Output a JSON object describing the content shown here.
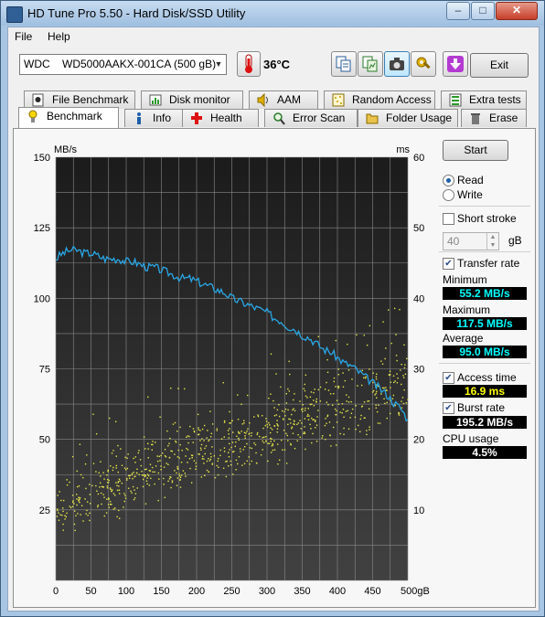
{
  "window": {
    "title": "HD Tune Pro 5.50 - Hard Disk/SSD Utility"
  },
  "titlebar_buttons": {
    "minimize": "–",
    "maximize": "□",
    "close": "✕"
  },
  "menu": {
    "file": "File",
    "help": "Help"
  },
  "toolbar": {
    "drive": "WDC    WD5000AAKX-001CA (500 gB)",
    "temperature": "36",
    "temperature_unit": "°C",
    "exit": "Exit"
  },
  "tabs_row1": [
    {
      "label": "File Benchmark",
      "icon": "file-benchmark-icon"
    },
    {
      "label": "Disk monitor",
      "icon": "disk-monitor-icon"
    },
    {
      "label": "AAM",
      "icon": "speaker-icon"
    },
    {
      "label": "Random Access",
      "icon": "random-access-icon"
    },
    {
      "label": "Extra tests",
      "icon": "extra-tests-icon"
    }
  ],
  "tabs_row2": [
    {
      "label": "Benchmark",
      "icon": "benchmark-icon"
    },
    {
      "label": "Info",
      "icon": "info-icon"
    },
    {
      "label": "Health",
      "icon": "health-icon"
    },
    {
      "label": "Error Scan",
      "icon": "magnifier-icon"
    },
    {
      "label": "Folder Usage",
      "icon": "folder-icon"
    },
    {
      "label": "Erase",
      "icon": "trash-icon"
    }
  ],
  "side": {
    "start": "Start",
    "read": "Read",
    "write": "Write",
    "short_stroke": "Short stroke",
    "short_stroke_value": "40",
    "short_stroke_unit": "gB",
    "transfer_rate": "Transfer rate",
    "minimum_label": "Minimum",
    "minimum": "55.2 MB/s",
    "maximum_label": "Maximum",
    "maximum": "117.5 MB/s",
    "average_label": "Average",
    "average": "95.0 MB/s",
    "access_time": "Access time",
    "access_time_value": "16.9 ms",
    "burst_rate": "Burst rate",
    "burst_rate_value": "195.2 MB/s",
    "cpu_usage_label": "CPU usage",
    "cpu_usage": "4.5%"
  },
  "colors": {
    "transfer_line": "#29a7e6",
    "access_points": "#e8e84a",
    "plot_bg_top": "#1b1b1b",
    "plot_bg_bottom": "#3f3f3f",
    "grid": "#8a8a8a"
  },
  "chart_data": {
    "type": "line",
    "left_unit": "MB/s",
    "right_unit": "ms",
    "x_unit": "gB",
    "xlim": [
      0,
      500
    ],
    "ylim_left": [
      0,
      150
    ],
    "ylim_right": [
      0,
      60
    ],
    "x_ticks": [
      0,
      50,
      100,
      150,
      200,
      250,
      300,
      350,
      400,
      450,
      500
    ],
    "y_ticks_left": [
      25,
      50,
      75,
      100,
      125,
      150
    ],
    "y_ticks_right": [
      10,
      20,
      30,
      40,
      50,
      60
    ],
    "grid": true,
    "series": [
      {
        "x": [
          0,
          10,
          20,
          30,
          40,
          50,
          60,
          70,
          80,
          90,
          100,
          110,
          120,
          130,
          140,
          150,
          160,
          170,
          180,
          190,
          200,
          210,
          220,
          230,
          240,
          250,
          260,
          270,
          280,
          290,
          300,
          310,
          320,
          330,
          340,
          350,
          360,
          370,
          380,
          390,
          400,
          410,
          420,
          430,
          440,
          450,
          460,
          470,
          480,
          490,
          500
        ],
        "values": [
          114,
          116,
          117,
          117,
          116,
          116,
          115,
          114,
          114,
          114,
          113,
          113,
          112,
          111,
          111,
          110,
          109,
          108,
          107,
          107,
          106,
          105,
          104,
          103,
          102,
          100,
          99,
          98,
          97,
          96,
          95,
          93,
          92,
          90,
          89,
          87,
          86,
          84,
          82,
          81,
          79,
          77,
          76,
          74,
          72,
          70,
          68,
          66,
          63,
          61,
          57
        ]
      },
      {
        "axis": "right",
        "style": "scatter",
        "x": [
          0,
          50,
          100,
          150,
          200,
          250,
          300,
          350,
          400,
          450,
          500
        ],
        "values_min": [
          4,
          8,
          9,
          11,
          13,
          14,
          16,
          17,
          19,
          20,
          22
        ],
        "values_max": [
          14,
          18,
          20,
          22,
          24,
          25,
          27,
          29,
          31,
          33,
          34
        ],
        "count": 800
      }
    ]
  }
}
